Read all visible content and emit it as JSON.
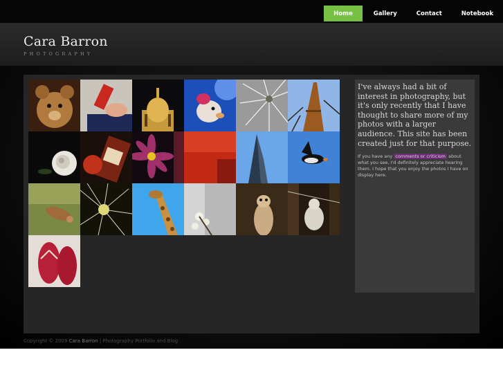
{
  "nav": {
    "items": [
      {
        "label": "Home",
        "active": true
      },
      {
        "label": "Gallery",
        "active": false
      },
      {
        "label": "Contact",
        "active": false
      },
      {
        "label": "Notebook",
        "active": false
      }
    ]
  },
  "header": {
    "title": "Cara Barron",
    "subtitle": "PHOTOGRAPHY"
  },
  "gallery": {
    "thumbnails": [
      "teddy-bear",
      "hand-with-bottle",
      "lit-dome",
      "toy-figure",
      "dandelion-seeds",
      "eiffel-tower",
      "white-rose",
      "whisky-bottle",
      "pink-flower",
      "skyscraper",
      "flying-puffin",
      "bird-in-grass",
      "dandelion-seedhead",
      "giraffe",
      "white-blossoms",
      "meerkat",
      "ragged-toy-on-string",
      "red-flip-flops"
    ]
  },
  "sidebar": {
    "intro": "I've always had a bit of interest in photography, but it's only recently that I have thought to share more of my photos with a larger audience. This site has been created just for that purpose.",
    "note_before": "If you have any",
    "note_link": "comments or criticism",
    "note_after": "about what you see, I'd definitely appreciate hearing them. I hope that you enjoy the photos I have on display here."
  },
  "footer": {
    "copyright": "Copyright © 2009",
    "name": "Cara Barron",
    "tagline": "| Photography Portfolio and Blog"
  },
  "colors": {
    "accent": "#76c043",
    "highlight": "#6a2f72"
  }
}
